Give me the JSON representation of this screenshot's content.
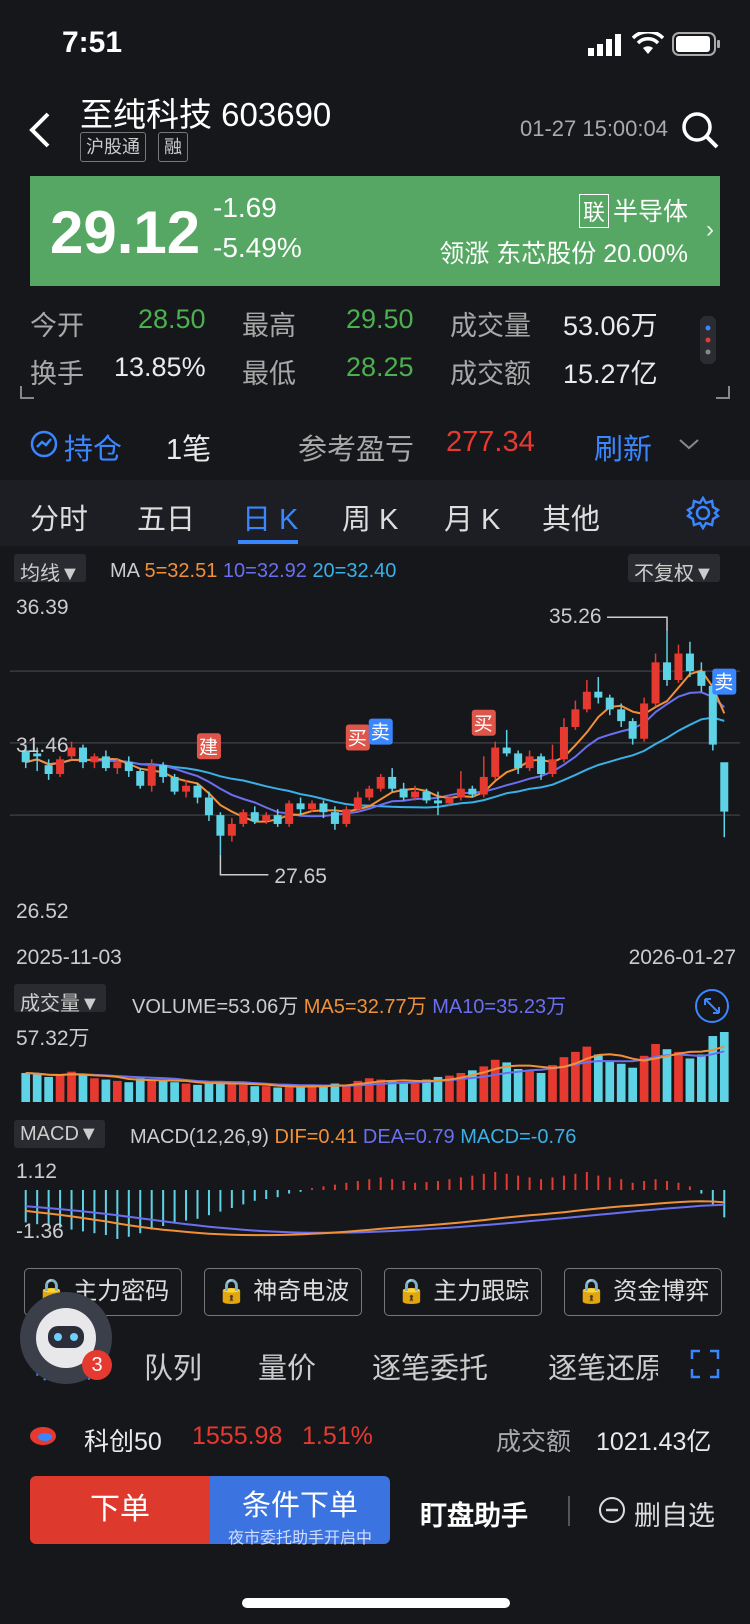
{
  "status": {
    "time": "7:51"
  },
  "header": {
    "title": "至纯科技 603690",
    "tags": [
      "沪股通",
      "融"
    ],
    "timestamp": "01-27 15:00:04"
  },
  "quote": {
    "price": "29.12",
    "change": "-1.69",
    "change_pct": "-5.49%",
    "sector_tag": "联",
    "sector": "半导体",
    "leader": "领涨 东芯股份 20.00%"
  },
  "stats": {
    "open_label": "今开",
    "open": "28.50",
    "high_label": "最高",
    "high": "29.50",
    "volume_label": "成交量",
    "volume": "53.06万",
    "turnover_label": "换手",
    "turnover": "13.85%",
    "low_label": "最低",
    "low": "28.25",
    "amount_label": "成交额",
    "amount": "15.27亿"
  },
  "position": {
    "label": "持仓",
    "count": "1笔",
    "pnl_label": "参考盈亏",
    "pnl": "277.34",
    "refresh": "刷新"
  },
  "tabs": [
    "分时",
    "五日",
    "日 K",
    "周 K",
    "月 K",
    "其他"
  ],
  "kline": {
    "ma_select": "均线▼",
    "ma_prefix": "MA",
    "ma5": "5=32.51",
    "ma10": "10=32.92",
    "ma20": "20=32.40",
    "adjust": "不复权▼",
    "y_high": "36.39",
    "y_mid": "31.46",
    "y_low": "26.52",
    "peak_label": "35.26",
    "trough_label": "27.65",
    "date_start": "2025-11-03",
    "date_end": "2026-01-27",
    "markers": {
      "build": "建",
      "buy": "买",
      "sell": "卖"
    }
  },
  "volume": {
    "select": "成交量▼",
    "label": "VOLUME=53.06万",
    "ma5": "MA5=32.77万",
    "ma10": "MA10=35.23万",
    "y_max": "57.32万"
  },
  "macd": {
    "select": "MACD▼",
    "params": "MACD(12,26,9)",
    "dif": "DIF=0.41",
    "dea": "DEA=0.79",
    "macd": "MACD=-0.76",
    "y_high": "1.12",
    "y_low": "-1.36"
  },
  "features": [
    "主力密码",
    "神奇电波",
    "主力跟踪",
    "资金博弈"
  ],
  "subtabs": [
    "明细",
    "队列",
    "量价",
    "逐笔委托",
    "逐笔还原"
  ],
  "avatar_badge": "3",
  "index": {
    "name": "科创50",
    "value": "1555.98",
    "pct": "1.51%",
    "amount_label": "成交额",
    "amount": "1021.43亿"
  },
  "bottom": {
    "order": "下单",
    "cond_order": "条件下单",
    "cond_sub": "夜市委托助手开启中",
    "assistant": "盯盘助手",
    "remove": "删自选"
  },
  "colors": {
    "up": "#e6392f",
    "down": "#5fd3e6",
    "accent": "#3a86ff",
    "quote_bg": "#56a763",
    "ma5": "#f0913a",
    "ma10": "#6a6ff0",
    "ma20": "#3ab0e8"
  },
  "chart_data": {
    "type": "candlestick",
    "title": "",
    "ylim": [
      26.52,
      36.39
    ],
    "ma": {
      "MA5": 32.51,
      "MA10": 32.92,
      "MA20": 32.4
    },
    "annotations": {
      "high": 35.26,
      "low": 27.65
    },
    "candles": [
      {
        "o": 31.2,
        "c": 30.8,
        "h": 31.4,
        "l": 30.6
      },
      {
        "o": 31.1,
        "c": 31.0,
        "h": 31.3,
        "l": 30.5
      },
      {
        "o": 30.7,
        "c": 30.4,
        "h": 30.9,
        "l": 30.2
      },
      {
        "o": 30.4,
        "c": 30.9,
        "h": 31.0,
        "l": 30.3
      },
      {
        "o": 31.0,
        "c": 31.3,
        "h": 31.5,
        "l": 30.9
      },
      {
        "o": 31.3,
        "c": 30.8,
        "h": 31.4,
        "l": 30.6
      },
      {
        "o": 30.8,
        "c": 31.0,
        "h": 31.1,
        "l": 30.6
      },
      {
        "o": 31.0,
        "c": 30.6,
        "h": 31.2,
        "l": 30.5
      },
      {
        "o": 30.6,
        "c": 30.8,
        "h": 30.9,
        "l": 30.4
      },
      {
        "o": 30.8,
        "c": 30.5,
        "h": 31.0,
        "l": 30.3
      },
      {
        "o": 30.5,
        "c": 30.0,
        "h": 30.6,
        "l": 29.9
      },
      {
        "o": 30.0,
        "c": 30.7,
        "h": 30.9,
        "l": 29.8
      },
      {
        "o": 30.7,
        "c": 30.3,
        "h": 30.8,
        "l": 30.1
      },
      {
        "o": 30.3,
        "c": 29.8,
        "h": 30.4,
        "l": 29.7
      },
      {
        "o": 29.8,
        "c": 30.0,
        "h": 30.2,
        "l": 29.6
      },
      {
        "o": 30.0,
        "c": 29.6,
        "h": 30.1,
        "l": 29.4
      },
      {
        "o": 29.6,
        "c": 29.0,
        "h": 29.8,
        "l": 28.8
      },
      {
        "o": 29.0,
        "c": 28.3,
        "h": 29.1,
        "l": 27.65
      },
      {
        "o": 28.3,
        "c": 28.7,
        "h": 28.9,
        "l": 28.1
      },
      {
        "o": 28.7,
        "c": 29.1,
        "h": 29.2,
        "l": 28.6
      },
      {
        "o": 29.1,
        "c": 28.8,
        "h": 29.3,
        "l": 28.7
      },
      {
        "o": 28.8,
        "c": 29.0,
        "h": 29.1,
        "l": 28.7
      },
      {
        "o": 29.0,
        "c": 28.7,
        "h": 29.2,
        "l": 28.6
      },
      {
        "o": 28.7,
        "c": 29.4,
        "h": 29.5,
        "l": 28.6
      },
      {
        "o": 29.4,
        "c": 29.2,
        "h": 29.6,
        "l": 29.0
      },
      {
        "o": 29.2,
        "c": 29.4,
        "h": 29.5,
        "l": 29.1
      },
      {
        "o": 29.4,
        "c": 29.1,
        "h": 29.5,
        "l": 28.9
      },
      {
        "o": 29.1,
        "c": 28.7,
        "h": 29.3,
        "l": 28.5
      },
      {
        "o": 28.7,
        "c": 29.2,
        "h": 29.3,
        "l": 28.6
      },
      {
        "o": 29.2,
        "c": 29.6,
        "h": 29.8,
        "l": 29.1
      },
      {
        "o": 29.6,
        "c": 29.9,
        "h": 30.0,
        "l": 29.5
      },
      {
        "o": 29.9,
        "c": 30.3,
        "h": 30.4,
        "l": 29.8
      },
      {
        "o": 30.3,
        "c": 29.9,
        "h": 30.6,
        "l": 29.8
      },
      {
        "o": 29.9,
        "c": 29.6,
        "h": 30.1,
        "l": 29.5
      },
      {
        "o": 29.6,
        "c": 29.8,
        "h": 30.0,
        "l": 29.5
      },
      {
        "o": 29.8,
        "c": 29.5,
        "h": 29.9,
        "l": 29.4
      },
      {
        "o": 29.5,
        "c": 29.4,
        "h": 29.8,
        "l": 29.0
      },
      {
        "o": 29.4,
        "c": 29.6,
        "h": 29.7,
        "l": 29.3
      },
      {
        "o": 29.6,
        "c": 29.9,
        "h": 30.5,
        "l": 29.5
      },
      {
        "o": 29.9,
        "c": 29.7,
        "h": 30.0,
        "l": 29.6
      },
      {
        "o": 29.7,
        "c": 30.3,
        "h": 31.0,
        "l": 29.6
      },
      {
        "o": 30.3,
        "c": 31.3,
        "h": 31.5,
        "l": 30.2
      },
      {
        "o": 31.3,
        "c": 31.1,
        "h": 31.9,
        "l": 31.0
      },
      {
        "o": 31.1,
        "c": 30.6,
        "h": 31.2,
        "l": 30.4
      },
      {
        "o": 30.6,
        "c": 31.0,
        "h": 31.2,
        "l": 30.5
      },
      {
        "o": 31.0,
        "c": 30.4,
        "h": 31.1,
        "l": 30.2
      },
      {
        "o": 30.4,
        "c": 30.9,
        "h": 31.4,
        "l": 30.3
      },
      {
        "o": 30.9,
        "c": 32.0,
        "h": 32.3,
        "l": 30.8
      },
      {
        "o": 32.0,
        "c": 32.6,
        "h": 32.9,
        "l": 31.9
      },
      {
        "o": 32.6,
        "c": 33.2,
        "h": 33.6,
        "l": 32.5
      },
      {
        "o": 33.2,
        "c": 33.0,
        "h": 33.7,
        "l": 32.8
      },
      {
        "o": 33.0,
        "c": 32.6,
        "h": 33.1,
        "l": 32.4
      },
      {
        "o": 32.6,
        "c": 32.2,
        "h": 32.8,
        "l": 32.0
      },
      {
        "o": 32.2,
        "c": 31.6,
        "h": 32.3,
        "l": 31.4
      },
      {
        "o": 31.6,
        "c": 32.8,
        "h": 33.0,
        "l": 31.5
      },
      {
        "o": 32.8,
        "c": 34.2,
        "h": 34.5,
        "l": 32.7
      },
      {
        "o": 34.2,
        "c": 33.6,
        "h": 35.26,
        "l": 33.4
      },
      {
        "o": 33.6,
        "c": 34.5,
        "h": 34.8,
        "l": 33.5
      },
      {
        "o": 34.5,
        "c": 33.9,
        "h": 34.9,
        "l": 33.7
      },
      {
        "o": 33.9,
        "c": 33.4,
        "h": 34.2,
        "l": 33.2
      },
      {
        "o": 33.4,
        "c": 31.4,
        "h": 33.5,
        "l": 31.2
      },
      {
        "o": 30.8,
        "c": 29.12,
        "h": 29.5,
        "l": 28.25
      }
    ],
    "volume": [
      22,
      21,
      19,
      20,
      23,
      21,
      18,
      17,
      16,
      15,
      18,
      17,
      16,
      15,
      14,
      13,
      14,
      15,
      14,
      13,
      12,
      12,
      11,
      12,
      11,
      13,
      12,
      14,
      13,
      16,
      18,
      17,
      16,
      15,
      14,
      17,
      19,
      20,
      22,
      24,
      27,
      32,
      30,
      25,
      24,
      22,
      28,
      34,
      38,
      42,
      36,
      31,
      29,
      26,
      35,
      44,
      40,
      38,
      33,
      36,
      50,
      53.06
    ],
    "macd_hist": [
      -0.9,
      -0.95,
      -1.0,
      -1.05,
      -1.1,
      -1.15,
      -1.2,
      -1.25,
      -1.36,
      -1.3,
      -1.2,
      -1.1,
      -1.0,
      -0.9,
      -0.85,
      -0.8,
      -0.7,
      -0.6,
      -0.5,
      -0.4,
      -0.3,
      -0.25,
      -0.2,
      -0.1,
      -0.05,
      0.05,
      0.1,
      0.15,
      0.2,
      0.25,
      0.3,
      0.35,
      0.3,
      0.25,
      0.2,
      0.22,
      0.25,
      0.3,
      0.35,
      0.4,
      0.45,
      0.5,
      0.45,
      0.4,
      0.35,
      0.3,
      0.35,
      0.4,
      0.45,
      0.5,
      0.4,
      0.35,
      0.3,
      0.2,
      0.25,
      0.3,
      0.25,
      0.2,
      0.1,
      -0.1,
      -0.4,
      -0.76
    ]
  }
}
